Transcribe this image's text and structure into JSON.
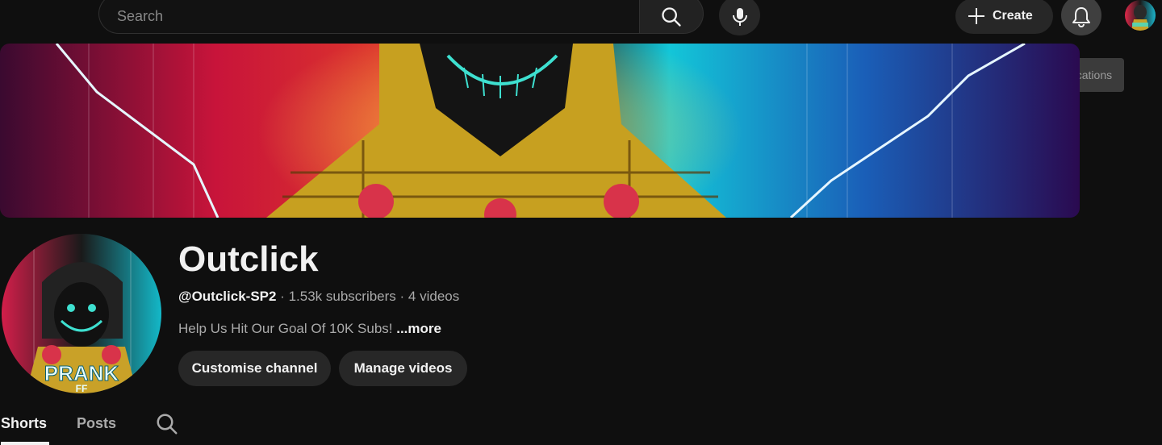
{
  "topbar": {
    "search_placeholder": "Search",
    "create_label": "Create",
    "tooltip": "Notifications"
  },
  "channel": {
    "name": "Outclick",
    "handle": "@Outclick-SP2",
    "separator1": " · ",
    "subscribers": "1.53k subscribers",
    "separator2": " · ",
    "videos": "4 videos",
    "description": "Help Us Hit Our Goal Of 10K Subs! ",
    "more_label": "...more",
    "avatar_text": "PRANK",
    "avatar_subtext": "FF",
    "buttons": {
      "customise": "Customise channel",
      "manage": "Manage videos"
    }
  },
  "tabs": [
    {
      "label": "Shorts",
      "selected": true
    },
    {
      "label": "Posts",
      "selected": false
    }
  ],
  "icons": {
    "search": "search-icon",
    "mic": "mic-icon",
    "create": "plus-icon",
    "bell": "bell-icon",
    "tab_search": "search-icon"
  },
  "colors": {
    "background": "#0f0f0f",
    "surface": "#272727",
    "text": "#f1f1f1",
    "muted": "#aaaaaa"
  }
}
